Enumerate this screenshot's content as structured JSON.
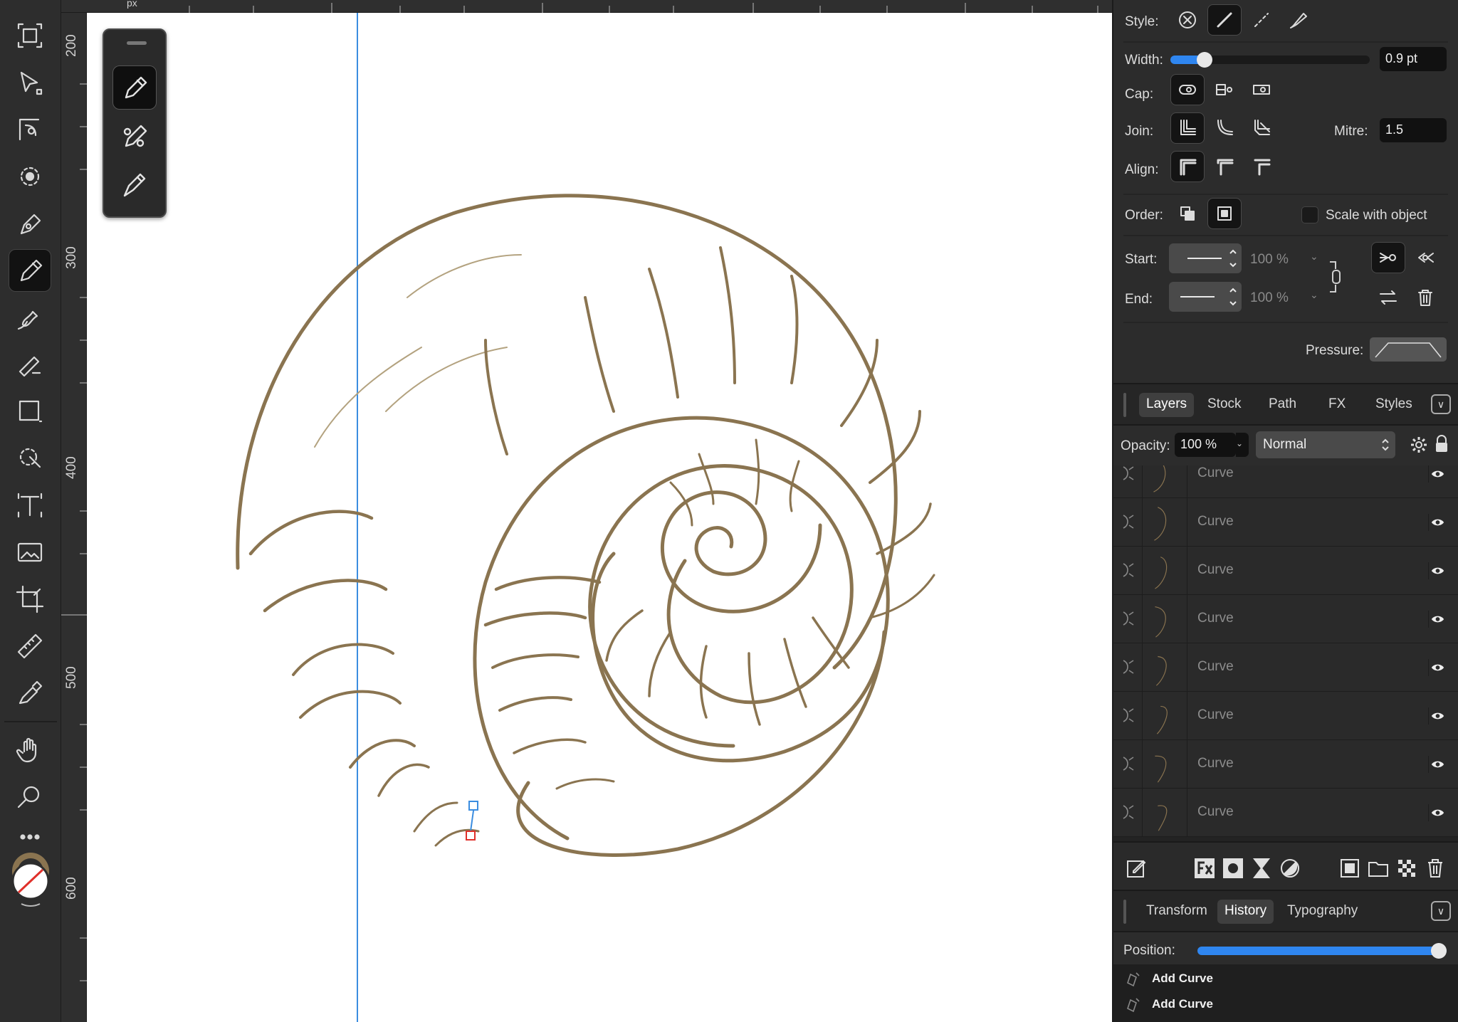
{
  "ruler": {
    "unit": "px",
    "left_labels": [
      "200",
      "300",
      "400",
      "500",
      "600"
    ]
  },
  "colors": {
    "canvas_bg": "#ffffff",
    "stroke_color": "#8a7450",
    "guide_color": "#3b8de0",
    "accent": "#2f86f0",
    "panel_bg": "#2c2c2c"
  },
  "tools": [
    {
      "name": "move-tool",
      "icon": "move-icon"
    },
    {
      "name": "node-tool",
      "icon": "node-icon"
    },
    {
      "name": "corner-tool",
      "icon": "corner-icon"
    },
    {
      "name": "point-transform-tool",
      "icon": "point-transform-icon"
    },
    {
      "name": "pen-tool",
      "icon": "pen-icon"
    },
    {
      "name": "pencil-tool",
      "icon": "pencil-icon",
      "active": true
    },
    {
      "name": "vector-brush-tool",
      "icon": "vector-brush-icon"
    },
    {
      "name": "fill-tool",
      "icon": "fill-icon"
    },
    {
      "name": "rectangle-tool",
      "icon": "rectangle-icon"
    },
    {
      "name": "vector-crop-tool",
      "icon": "vector-crop-icon"
    },
    {
      "name": "artistic-text-tool",
      "icon": "text-icon"
    },
    {
      "name": "place-image-tool",
      "icon": "image-icon"
    },
    {
      "name": "crop-tool",
      "icon": "crop-icon"
    },
    {
      "name": "measure-tool",
      "icon": "ruler-icon"
    },
    {
      "name": "color-picker-tool",
      "icon": "eyedropper-icon"
    },
    {
      "name": "view-tool",
      "icon": "hand-icon"
    },
    {
      "name": "zoom-tool",
      "icon": "zoom-icon"
    },
    {
      "name": "more-tools",
      "icon": "more-icon"
    }
  ],
  "stroke_panel": {
    "style_label": "Style:",
    "width_label": "Width:",
    "width_value": "0.9 pt",
    "width_fraction": 0.17,
    "cap_label": "Cap:",
    "join_label": "Join:",
    "mitre_label": "Mitre:",
    "mitre_value": "1.5",
    "align_label": "Align:",
    "order_label": "Order:",
    "scale_with_object_label": "Scale with object",
    "scale_with_object_checked": false,
    "start_label": "Start:",
    "end_label": "End:",
    "start_percent": "100 %",
    "end_percent": "100 %",
    "pressure_label": "Pressure:"
  },
  "layers_panel": {
    "tabs": [
      "Layers",
      "Stock",
      "Path",
      "FX",
      "Styles"
    ],
    "active_tab": "Layers",
    "opacity_label": "Opacity:",
    "opacity_value": "100 %",
    "blend_mode": "Normal",
    "layers": [
      {
        "name": "Curve"
      },
      {
        "name": "Curve"
      },
      {
        "name": "Curve"
      },
      {
        "name": "Curve"
      },
      {
        "name": "Curve"
      },
      {
        "name": "Curve"
      },
      {
        "name": "Curve"
      },
      {
        "name": "Curve"
      }
    ]
  },
  "bottom_panel": {
    "tabs": [
      "Transform",
      "History",
      "Typography"
    ],
    "active_tab": "History",
    "position_label": "Position:",
    "position_fraction": 1.0,
    "history": [
      {
        "label": "Add Curve"
      },
      {
        "label": "Add Curve"
      }
    ]
  }
}
